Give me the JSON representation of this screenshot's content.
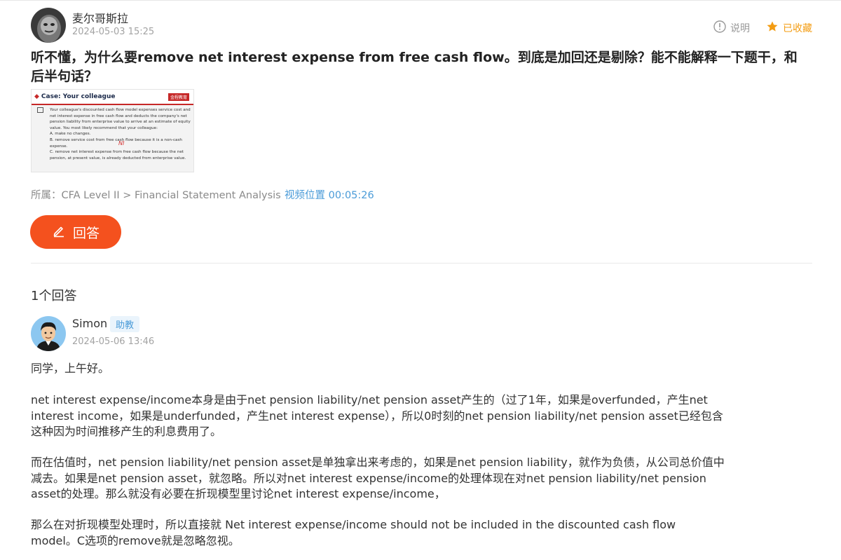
{
  "question": {
    "user_name": "麦尔哥斯拉",
    "timestamp": "2024-05-03 15:25",
    "explain_label": "说明",
    "favorite_label": "已收藏",
    "title": "听不懂，为什么要remove net interest expense from free cash flow。到底是加回还是剔除？能不能解释一下题干，和后半句话？",
    "thumbnail": {
      "header": "Case: Your colleague",
      "logo_text": "金程教育",
      "body_lines": [
        "Your colleague's discounted cash flow model expenses service cost and",
        "net interest expense in free cash flow and deducts the company's net",
        "pension liability from enterprise value to arrive at an estimate of equity",
        "value. You most likely recommend that your colleague:",
        "A. make no changes.",
        "B. remove service cost from free cash flow because it is a non-cash",
        "expense.",
        "C. remove net interest expense from free cash flow because the net",
        "pension, at present value, is already deducted from enterprise value."
      ],
      "handwritten": "NI"
    },
    "category": "所属：CFA Level II > Financial Statement Analysis",
    "video_position": "视频位置 00:05:26",
    "answer_button_label": "回答"
  },
  "answers_section": {
    "count_label": "1个回答"
  },
  "answer": {
    "user_name": "Simon",
    "role_badge": "助教",
    "timestamp": "2024-05-06 13:46",
    "paragraphs": [
      "同学，上午好。",
      "net interest expense/income本身是由于net pension liability/net pension asset产生的（过了1年，如果是overfunded，产生net interest income，如果是underfunded，产生net interest expense），所以0时刻的net pension liability/net pension asset已经包含这种因为时间推移产生的利息费用了。",
      "而在估值时，net pension liability/net pension asset是单独拿出来考虑的，如果是net pension liability，就作为负债，从公司总价值中减去。如果是net pension asset，就忽略。所以对net interest expense/income的处理体现在对net pension liability/net pension asset的处理。那么就没有必要在折现模型里讨论net interest expense/income，",
      "那么在对折现模型处理时，所以直接就 Net interest expense/income should not be included in the discounted cash flow model。C选项的remove就是忽略忽视。"
    ]
  },
  "colors": {
    "accent": "#f4511e",
    "link": "#4a9bd8",
    "favorite": "#f39c12"
  }
}
